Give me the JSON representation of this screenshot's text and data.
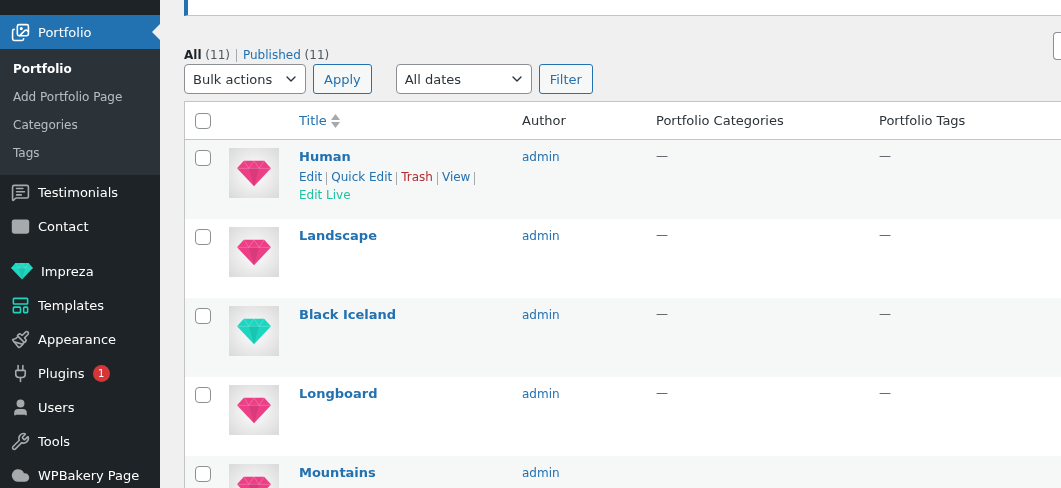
{
  "sidebar": {
    "items": [
      {
        "label": "Portfolio",
        "selected": true,
        "children": [
          {
            "label": "Portfolio",
            "selected": true
          },
          {
            "label": "Add Portfolio Page",
            "selected": false
          },
          {
            "label": "Categories",
            "selected": false
          },
          {
            "label": "Tags",
            "selected": false
          }
        ]
      },
      {
        "label": "Testimonials",
        "selected": false
      },
      {
        "label": "Contact",
        "selected": false
      },
      {
        "label": "Impreza",
        "selected": false
      },
      {
        "label": "Templates",
        "selected": false
      },
      {
        "label": "Appearance",
        "selected": false
      },
      {
        "label": "Plugins",
        "selected": false,
        "badge": "1"
      },
      {
        "label": "Users",
        "selected": false
      },
      {
        "label": "Tools",
        "selected": false
      },
      {
        "label": "WPBakery Page",
        "selected": false
      }
    ]
  },
  "views": [
    {
      "label": "All",
      "count": "(11)",
      "selected": true
    },
    {
      "label": "Published",
      "count": "(11)",
      "selected": false
    }
  ],
  "bulk_actions": {
    "value": "Bulk actions",
    "button": "Apply"
  },
  "date_filter": {
    "value": "All dates",
    "button": "Filter"
  },
  "table": {
    "select_all_checked": false,
    "columns": [
      "Title",
      "Author",
      "Portfolio Categories",
      "Portfolio Tags"
    ],
    "rows": [
      {
        "title": "Human",
        "author": "admin",
        "categories": "—",
        "tags": "—",
        "color": "#ec3f86",
        "checked": false,
        "actions": [
          {
            "label": "Edit",
            "kind": "link"
          },
          {
            "label": "Quick Edit",
            "kind": "link"
          },
          {
            "label": "Trash",
            "kind": "trash"
          },
          {
            "label": "View",
            "kind": "link"
          },
          {
            "label": "Edit Live",
            "kind": "live"
          }
        ]
      },
      {
        "title": "Landscape",
        "author": "admin",
        "categories": "—",
        "tags": "—",
        "color": "#ec3f86",
        "checked": false
      },
      {
        "title": "Black Iceland",
        "author": "admin",
        "categories": "—",
        "tags": "—",
        "color": "#1cd6c0",
        "checked": false
      },
      {
        "title": "Longboard",
        "author": "admin",
        "categories": "—",
        "tags": "—",
        "color": "#ec3f86",
        "checked": false
      },
      {
        "title": "Mountains",
        "author": "admin",
        "categories": "",
        "tags": "",
        "color": "#ec3f86",
        "checked": false
      }
    ]
  }
}
